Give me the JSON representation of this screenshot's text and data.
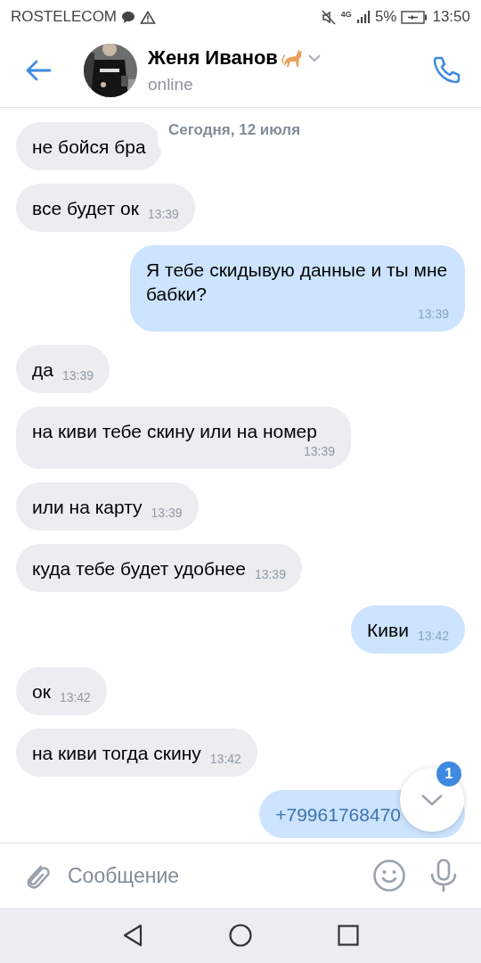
{
  "status_bar": {
    "carrier": "ROSTELECOM",
    "network": "4G",
    "battery": "5%",
    "time": "13:50"
  },
  "header": {
    "name": "Женя Иванов",
    "status": "online"
  },
  "date_label": "Сегодня, 12 июля",
  "messages": [
    {
      "kind": "incoming",
      "text": "не бойся бра",
      "link": false
    },
    {
      "kind": "incoming",
      "text": "все будет ок",
      "time": "13:39",
      "link": false
    },
    {
      "kind": "outgoing",
      "text": "Я тебе скидывую данные и ты мне бабки?",
      "time": "13:39",
      "link": false
    },
    {
      "kind": "incoming",
      "text": "да",
      "time": "13:39",
      "link": false
    },
    {
      "kind": "incoming",
      "text": "на киви тебе скину или на номер",
      "time": "13:39",
      "link": false
    },
    {
      "kind": "incoming",
      "text": "или на карту",
      "time": "13:39",
      "link": false
    },
    {
      "kind": "incoming",
      "text": "куда тебе будет удобнее",
      "time": "13:39",
      "link": false
    },
    {
      "kind": "outgoing",
      "text": "Киви",
      "time": "13:42",
      "link": false
    },
    {
      "kind": "incoming",
      "text": "ок",
      "time": "13:42",
      "link": false
    },
    {
      "kind": "incoming",
      "text": "на киви тогда скину",
      "time": "13:42",
      "link": false
    },
    {
      "kind": "outgoing",
      "text": "+79961768470",
      "link": true
    }
  ],
  "scroll_badge": "1",
  "composer": {
    "placeholder": "Сообщение"
  }
}
